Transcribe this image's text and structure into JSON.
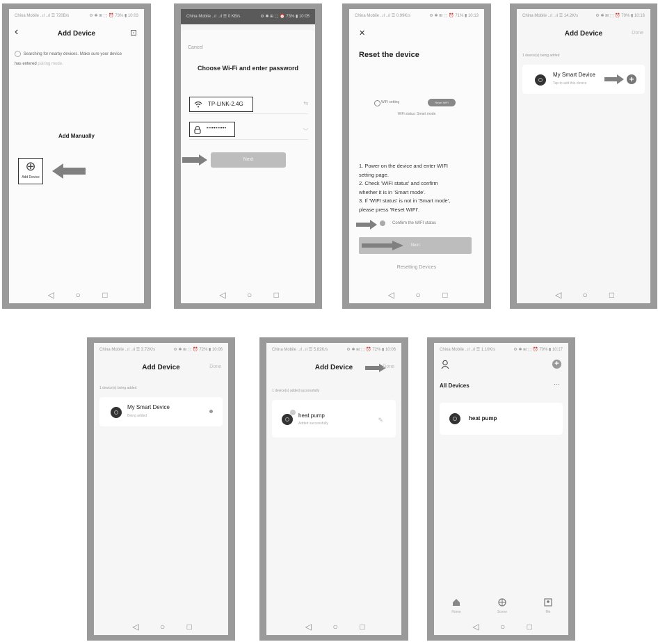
{
  "status_bar": {
    "s1": {
      "left": "China Mobile ..ıl ..ıl ☰ 720B/s",
      "right": "⚙ ✱ ⊞ ⬚ ⏰ 73% ▮ 10:03"
    },
    "s2": {
      "left": "China Mobile ..ıl ..ıl ☰ 0 KB/s",
      "right": "⚙ ✱ ⊞ ⬚ ⏰ 73% ▮ 10:05"
    },
    "s3": {
      "left": "China Mobile ..ıl ..ıl ☰ 0.99K/s",
      "right": "⚙ ✱ ⊞ ⬚ ⏰ 71% ▮ 10:13"
    },
    "s4": {
      "left": "China Mobile ..ıl ..ıl ☰ 14.2K/s",
      "right": "⚙ ✱ ⊞ ⬚ ⏰ 70% ▮ 10:16"
    },
    "s5": {
      "left": "China Mobile ..ıl ..ıl ☰ 3.72K/s",
      "right": "⚙ ✱ ⊞ ⬚ ⏰ 72% ▮ 10:06"
    },
    "s6": {
      "left": "China Mobile ..ıl ..ıl ☰ 5.82K/s",
      "right": "⚙ ✱ ⊞ ⬚ ⏰ 72% ▮ 10:06"
    },
    "s7": {
      "left": "China Mobile ..ıl ..ıl ☰ 1.10K/s",
      "right": "⚙ ✱ ⊞ ⬚ ⏰ 70% ▮ 10:17"
    }
  },
  "nav_bar": {
    "back": "◁",
    "home": "○",
    "recent": "□"
  },
  "screen1": {
    "back_icon": "‹",
    "title": "Add Device",
    "scan_icon": "⊡",
    "searching_line1": "Searching for nearby devices. Make sure your device",
    "searching_line2": "has entered",
    "pairing_mode": "pairing mode.",
    "add_manually": "Add Manually",
    "plus_icon": "⊕",
    "add_device_label": "Add Device"
  },
  "screen2": {
    "cancel": "Cancel",
    "title": "Choose Wi-Fi and enter password",
    "wifi_icon": "wifi-icon",
    "ssid": "TP-LINK-2.4G",
    "swap_icon": "⇆",
    "lock_icon": "lock-icon",
    "password": "•••••••••••",
    "eye_icon": "◡",
    "next": "Next"
  },
  "screen3": {
    "close_icon": "✕",
    "title": "Reset the device",
    "wifi_setting": "WiFi setting",
    "pill": "Reset WiFi",
    "status_caption": "WiFi status: Smart mode",
    "steps": [
      "1. Power on the device and enter WIFI",
      "setting page.",
      "2. Check 'WIFI status' and confirm",
      "whether it is in 'Smart mode'.",
      "3. If 'WIFI status' is not in 'Smart mode',",
      "please press 'Reset WIFI'."
    ],
    "confirm": "Confirm the WIFI status",
    "next": "Next",
    "resetting": "Resetting Devices"
  },
  "screen4": {
    "title": "Add Device",
    "done": "Done",
    "being_added": "1 device(s) being added",
    "device_name": "My Smart Device",
    "device_sub": "Tap to add this device",
    "add_icon": "+"
  },
  "screen5": {
    "title": "Add Device",
    "done": "Done",
    "being_added": "1 device(s) being added",
    "device_name": "My Smart Device",
    "device_sub": "Being added"
  },
  "screen6": {
    "title": "Add Device",
    "done": "Done",
    "added_count": "1 device(s) added successfully",
    "device_name": "heat pump",
    "device_sub": "Added successfully",
    "edit_icon": "✎"
  },
  "screen7": {
    "profile_icon": "person-icon",
    "add_icon": "+",
    "section": "All Devices",
    "more": "···",
    "device_name": "heat pump",
    "tabs": [
      {
        "label": "Home",
        "icon": "home-icon"
      },
      {
        "label": "Scene",
        "icon": "scene-icon"
      },
      {
        "label": "Me",
        "icon": "me-icon"
      }
    ]
  },
  "colors": {
    "frame": "#9a9a9a",
    "arrow": "#808080",
    "next_button": "#bdbdbd",
    "screen_bg": "#fbfbfb"
  }
}
